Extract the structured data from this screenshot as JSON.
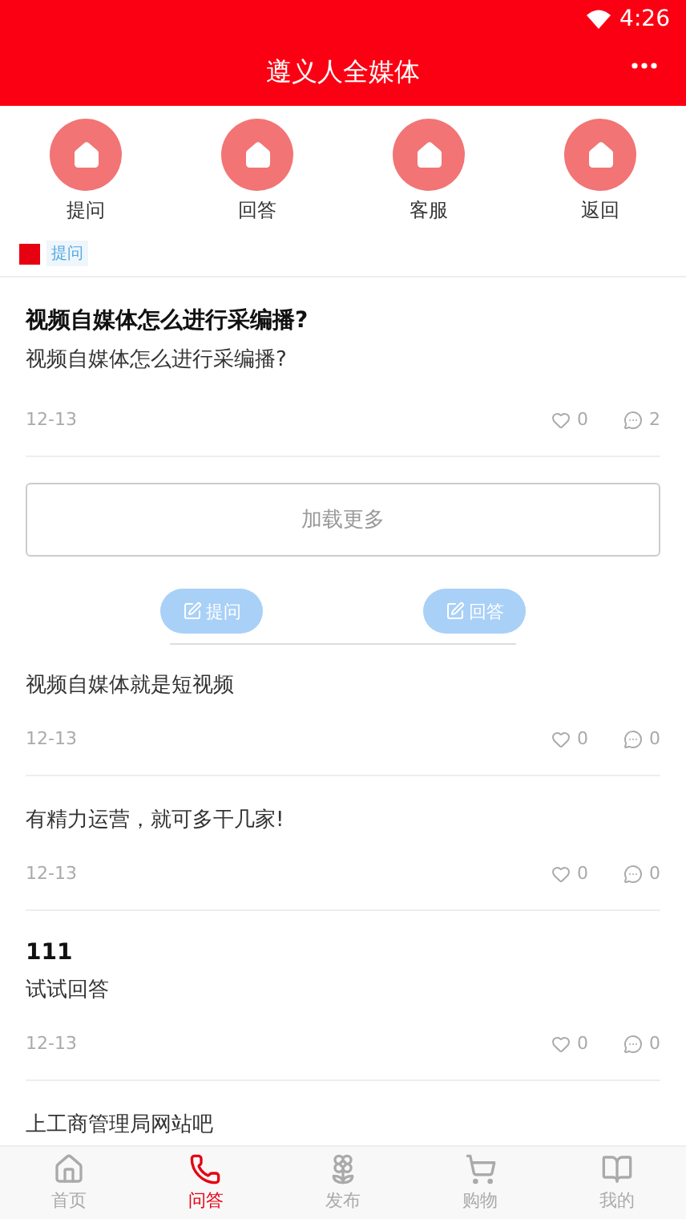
{
  "status_bar": {
    "time": "4:26"
  },
  "header": {
    "title": "遵义人全媒体"
  },
  "quick_nav": [
    {
      "label": "提问"
    },
    {
      "label": "回答"
    },
    {
      "label": "客服"
    },
    {
      "label": "返回"
    }
  ],
  "tag": {
    "label": "提问"
  },
  "question": {
    "title": "视频自媒体怎么进行采编播?",
    "body": "视频自媒体怎么进行采编播?",
    "date": "12-13",
    "likes": "0",
    "comments": "2"
  },
  "load_more": "加载更多",
  "action_buttons": [
    {
      "label": "提问"
    },
    {
      "label": "回答"
    }
  ],
  "answers": [
    {
      "text": "视频自媒体就是短视频",
      "date": "12-13",
      "likes": "0",
      "comments": "0"
    },
    {
      "text": "有精力运营，就可多干几家!",
      "date": "12-13",
      "likes": "0",
      "comments": "0"
    },
    {
      "title": "111",
      "text": "试试回答",
      "date": "12-13",
      "likes": "0",
      "comments": "0"
    },
    {
      "text": "上工商管理局网站吧"
    }
  ],
  "tab_bar": [
    {
      "label": "首页",
      "selected": false
    },
    {
      "label": "问答",
      "selected": true
    },
    {
      "label": "发布",
      "selected": false
    },
    {
      "label": "购物",
      "selected": false
    },
    {
      "label": "我的",
      "selected": false
    }
  ]
}
